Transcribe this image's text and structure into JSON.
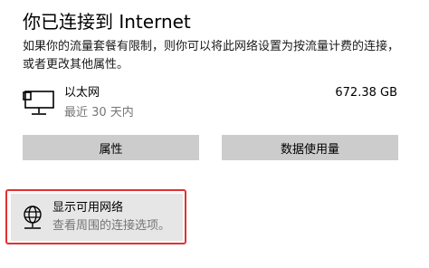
{
  "status": {
    "title": "你已连接到 Internet",
    "description": "如果你的流量套餐有限制，则你可以将此网络设置为按流量计费的连接，或者更改其他属性。"
  },
  "connection": {
    "icon": "ethernet-pc-icon",
    "name": "以太网",
    "subtitle": "最近 30 天内",
    "usage": "672.38 GB"
  },
  "buttons": {
    "properties": "属性",
    "data_usage": "数据使用量"
  },
  "available_networks": {
    "icon": "globe-network-icon",
    "title": "显示可用网络",
    "subtitle": "查看周围的连接选项。"
  },
  "colors": {
    "highlight_outline": "#e03131",
    "button_bg": "#cccccc"
  }
}
